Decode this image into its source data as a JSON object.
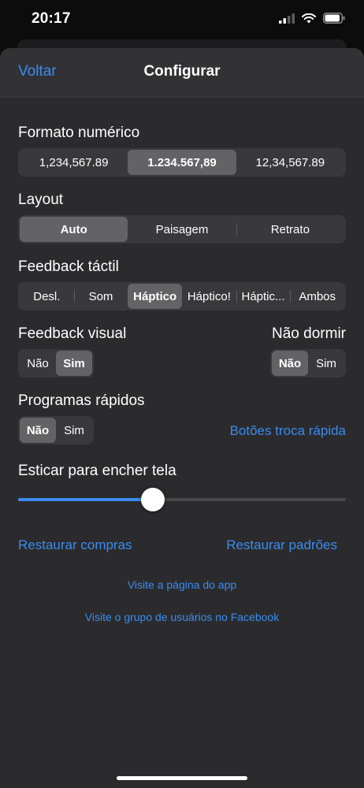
{
  "status_bar": {
    "time": "20:17",
    "icons": [
      "signal-icon",
      "wifi-icon",
      "battery-icon"
    ]
  },
  "nav": {
    "back_label": "Voltar",
    "title": "Configurar"
  },
  "number_format": {
    "label": "Formato numérico",
    "options": [
      "1,234,567.89",
      "1.234.567,89",
      "12,34,567.89"
    ],
    "selected": "1.234.567,89"
  },
  "layout": {
    "label": "Layout",
    "options": [
      "Auto",
      "Paisagem",
      "Retrato"
    ],
    "selected": "Auto"
  },
  "tactile_feedback": {
    "label": "Feedback táctil",
    "options": [
      "Desl.",
      "Som",
      "Háptico",
      "Háptico!",
      "Háptic...",
      "Ambos"
    ],
    "selected": "Háptico"
  },
  "visual_feedback": {
    "label": "Feedback visual",
    "options": [
      "Não",
      "Sim"
    ],
    "selected": "Sim"
  },
  "no_sleep": {
    "label": "Não dormir",
    "options": [
      "Não",
      "Sim"
    ],
    "selected": "Não"
  },
  "quick_programs": {
    "label": "Programas rápidos",
    "options": [
      "Não",
      "Sim"
    ],
    "selected": "Não"
  },
  "quick_swap_link": "Botões troca rápida",
  "stretch": {
    "label": "Esticar para encher tela",
    "value": 0.41
  },
  "links": {
    "restore_purchases": "Restaurar compras",
    "restore_defaults": "Restaurar padrões",
    "visit_app_page": "Visite a página do app",
    "visit_facebook": "Visite o grupo de usuários no Facebook"
  },
  "colors": {
    "accent": "#3a8cf0",
    "background": "#2b2b2d",
    "segment_bg": "#39393c",
    "segment_selected": "#636366"
  }
}
